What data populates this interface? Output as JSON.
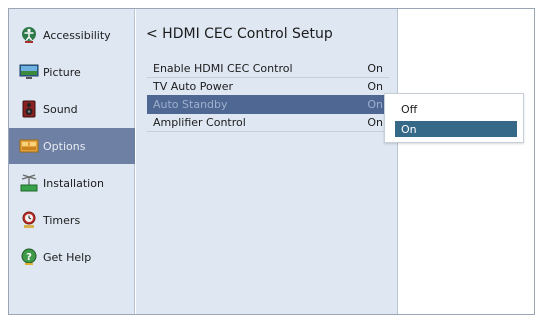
{
  "sidebar": {
    "items": [
      {
        "label": "Accessibility",
        "icon": "accessibility-icon"
      },
      {
        "label": "Picture",
        "icon": "picture-icon"
      },
      {
        "label": "Sound",
        "icon": "speaker-icon"
      },
      {
        "label": "Options",
        "icon": "options-icon",
        "selected": true
      },
      {
        "label": "Installation",
        "icon": "antenna-icon"
      },
      {
        "label": "Timers",
        "icon": "timer-icon"
      },
      {
        "label": "Get Help",
        "icon": "help-icon"
      }
    ]
  },
  "panel": {
    "title": "< HDMI CEC Control Setup",
    "rows": [
      {
        "label": "Enable HDMI CEC Control",
        "value": "On"
      },
      {
        "label": "TV Auto Power",
        "value": "On"
      },
      {
        "label": "Auto Standby",
        "value": "On",
        "selected": true
      },
      {
        "label": "Amplifier Control",
        "value": "On"
      }
    ]
  },
  "dropdown": {
    "options": [
      "Off",
      "On"
    ],
    "selected": "On"
  },
  "colors": {
    "sidebar_bg": "#dfe7f2",
    "sidebar_selected": "#6e80a3",
    "row_selected": "#4e6793",
    "option_selected": "#366988"
  }
}
